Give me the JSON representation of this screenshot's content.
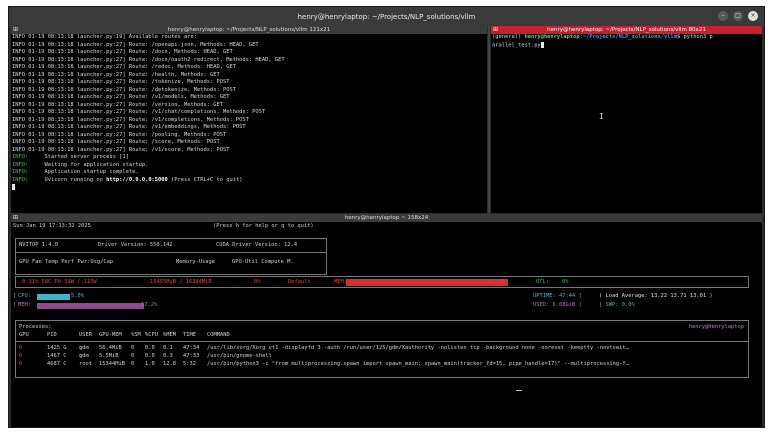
{
  "window": {
    "title": "henry@henrylaptop: ~/Projects/NLP_solutions/vllm",
    "buttons": [
      "–",
      "□",
      "×"
    ]
  },
  "pane_top_left": {
    "title": "henry@henrylaptop: ~/Projects/NLP_solutions/vllm 121x21",
    "lines": [
      {
        "pre": "INFO 01-19 08:13:18 launcher.py:19] Available routes are:",
        "cls": ""
      },
      {
        "pre": "INFO 01-19 08:13:18 launcher.py:27] Route: /openapi.json, Methods: HEAD, GET",
        "cls": ""
      },
      {
        "pre": "INFO 01-19 08:13:18 launcher.py:27] Route: /docs, Methods: HEAD, GET",
        "cls": ""
      },
      {
        "pre": "INFO 01-19 08:13:18 launcher.py:27] Route: /docs/oauth2-redirect, Methods: HEAD, GET",
        "cls": ""
      },
      {
        "pre": "INFO 01-19 08:13:18 launcher.py:27] Route: /redoc, Methods: HEAD, GET",
        "cls": ""
      },
      {
        "pre": "INFO 01-19 08:13:18 launcher.py:27] Route: /health, Methods: GET",
        "cls": ""
      },
      {
        "pre": "INFO 01-19 08:13:18 launcher.py:27] Route: /tokenize, Methods: POST",
        "cls": ""
      },
      {
        "pre": "INFO 01-19 08:13:18 launcher.py:27] Route: /detokenize, Methods: POST",
        "cls": ""
      },
      {
        "pre": "INFO 01-19 08:13:18 launcher.py:27] Route: /v1/models, Methods: GET",
        "cls": ""
      },
      {
        "pre": "INFO 01-19 08:13:18 launcher.py:27] Route: /version, Methods: GET",
        "cls": ""
      },
      {
        "pre": "INFO 01-19 08:13:18 launcher.py:27] Route: /v1/chat/completions, Methods: POST",
        "cls": ""
      },
      {
        "pre": "INFO 01-19 08:13:18 launcher.py:27] Route: /v1/completions, Methods: POST",
        "cls": ""
      },
      {
        "pre": "INFO 01-19 08:13:18 launcher.py:27] Route: /v1/embeddings, Methods: POST",
        "cls": ""
      },
      {
        "pre": "INFO 01-19 08:13:18 launcher.py:27] Route: /pooling, Methods: POST",
        "cls": ""
      },
      {
        "pre": "INFO 01-19 08:13:18 launcher.py:27] Route: /score, Methods: POST",
        "cls": ""
      },
      {
        "pre": "INFO 01-19 08:13:18 launcher.py:27] Route: /v1/score, Methods: POST",
        "cls": ""
      }
    ],
    "info_lines": [
      {
        "tag": "INFO:",
        "text": "     Started server process [1]"
      },
      {
        "tag": "INFO:",
        "text": "     Waiting for application startup."
      },
      {
        "tag": "INFO:",
        "text": "     Application startup complete."
      }
    ],
    "uvicorn": {
      "tag": "INFO:",
      "pre": "     Uvicorn running on ",
      "url": "http://0.0.0.0:5000",
      "post": " (Press CTRL+C to quit)"
    }
  },
  "pane_top_right": {
    "title": "henry@henrylaptop: ~/Projects/NLP_solutions/vllm 80x21",
    "env": "(general)",
    "user": "henry@henrylaptop",
    "path": ":~/Projects/NLP_solutions/vllm",
    "cmd": "$ python3 p",
    "cmd2": "arallel_test.py"
  },
  "pane_bottom": {
    "title": "henry@henrylaptop ~ 158x24",
    "datetime": "Sun Jan 19 17:13:32 2025",
    "help": "(Press h for help or q to quit)",
    "nvitop": "NVITOP 1.4.0",
    "driver": "Driver Version: 550.142",
    "cuda": "CUDA Driver Version: 12.4",
    "hdr1": "GPU Fan Temp Perf Pwr:Usg/Cap",
    "hdr2": "Memory-Usage",
    "hdr3": "GPU-Util  Compute M.",
    "gpu_stats": "0  11%  58C  P0   59W / 115W",
    "gpu_mem": "15455MiB / 16384MiB",
    "gpu_util": "0%",
    "compute_mode": "Default",
    "mem_label": "MEM:",
    "mem_pct_label": "95.0%",
    "mem_fraction": 0.95,
    "util_label": "UTL:",
    "util_pct": "0%",
    "cpu_label": "CPU:",
    "cpu_pct": "5.0%",
    "cpu_fraction": 0.05,
    "ram_label": "MEM:",
    "ram_pct": "17.2%",
    "ram_fraction": 0.172,
    "uptime": "UPTIME: 47:44 ]",
    "load": "( Load Average: 13.22 13.71 13.01 )",
    "used": "USED: 6.08GiB ]",
    "swp": "[ SWP: 0.0%",
    "proc_title": "Processes:",
    "proc_user": "henry@henrylaptop",
    "proc_header": [
      "GPU",
      "PID",
      "USER",
      "GPU-MEM",
      "%SM",
      "%CPU",
      "%MEM",
      "TIME",
      "COMMAND"
    ],
    "processes": [
      [
        "0",
        "1425 G",
        "gdm",
        "56.4MiB",
        "0",
        "0.0",
        "0.1",
        "47:34",
        "/usr/lib/xorg/Xorg vt1 -displayfd 3 -auth /run/user/125/gdm/Xauthority -nolisten tcp -background none -noreset -keeptty -novtswit…"
      ],
      [
        "0",
        "1467 C",
        "gdm",
        "5.5MiB",
        "0",
        "0.0",
        "0.3",
        "47:33",
        "/usr/bin/gnome-shell"
      ],
      [
        "0",
        "4687 C",
        "root",
        "15344MiB",
        "0",
        "1.0",
        "12.8",
        "5:32",
        "/usr/bin/python3 -c \"from multiprocessing.spawn import spawn_main; spawn_main(tracker_fd=15, pipe_handle=17)\" --multiprocessing-f…"
      ]
    ]
  }
}
